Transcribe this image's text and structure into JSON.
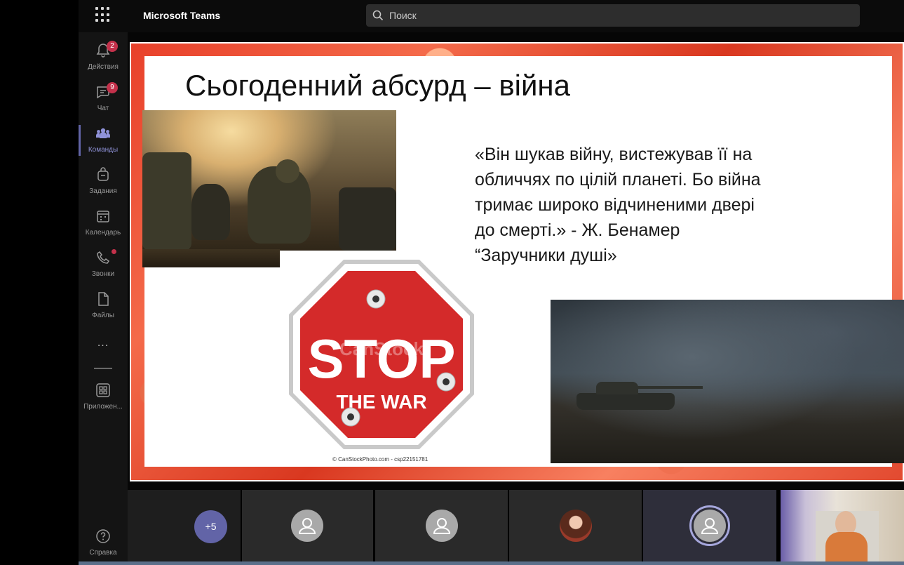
{
  "app": {
    "title": "Microsoft Teams"
  },
  "search": {
    "placeholder": "Поиск"
  },
  "rail": {
    "items": [
      {
        "label": "Действия",
        "icon": "bell-icon",
        "badge": "2"
      },
      {
        "label": "Чат",
        "icon": "chat-icon",
        "badge": "9"
      },
      {
        "label": "Команды",
        "icon": "teams-icon",
        "active": true
      },
      {
        "label": "Задания",
        "icon": "assignments-icon"
      },
      {
        "label": "Календарь",
        "icon": "calendar-icon"
      },
      {
        "label": "Звонки",
        "icon": "phone-icon",
        "dot": true
      },
      {
        "label": "Файлы",
        "icon": "file-icon"
      },
      {
        "label": "...",
        "icon": "more-icon"
      },
      {
        "label": "Приложен...",
        "icon": "apps-icon"
      },
      {
        "label": "Справка",
        "icon": "help-icon"
      }
    ]
  },
  "slide": {
    "title": "Сьогоденний абсурд – війна",
    "quote_lines": [
      "«Він шукав війну, вистежував її на",
      "обличчях по цілій планеті. Бо війна",
      "тримає широко відчиненими двері",
      "до смерті.» - Ж. Бенамер",
      "“Заручники душі»"
    ],
    "stop_sign": {
      "word": "STOP",
      "subtitle": "THE WAR",
      "watermark": "CanStock"
    },
    "stop_credit": "© CanStockPhoto.com - csp22151781"
  },
  "participants": {
    "more_count": "+5"
  },
  "colors": {
    "accent": "#6264a7",
    "stop_red": "#d42a2a",
    "badge_red": "#c4314b"
  }
}
